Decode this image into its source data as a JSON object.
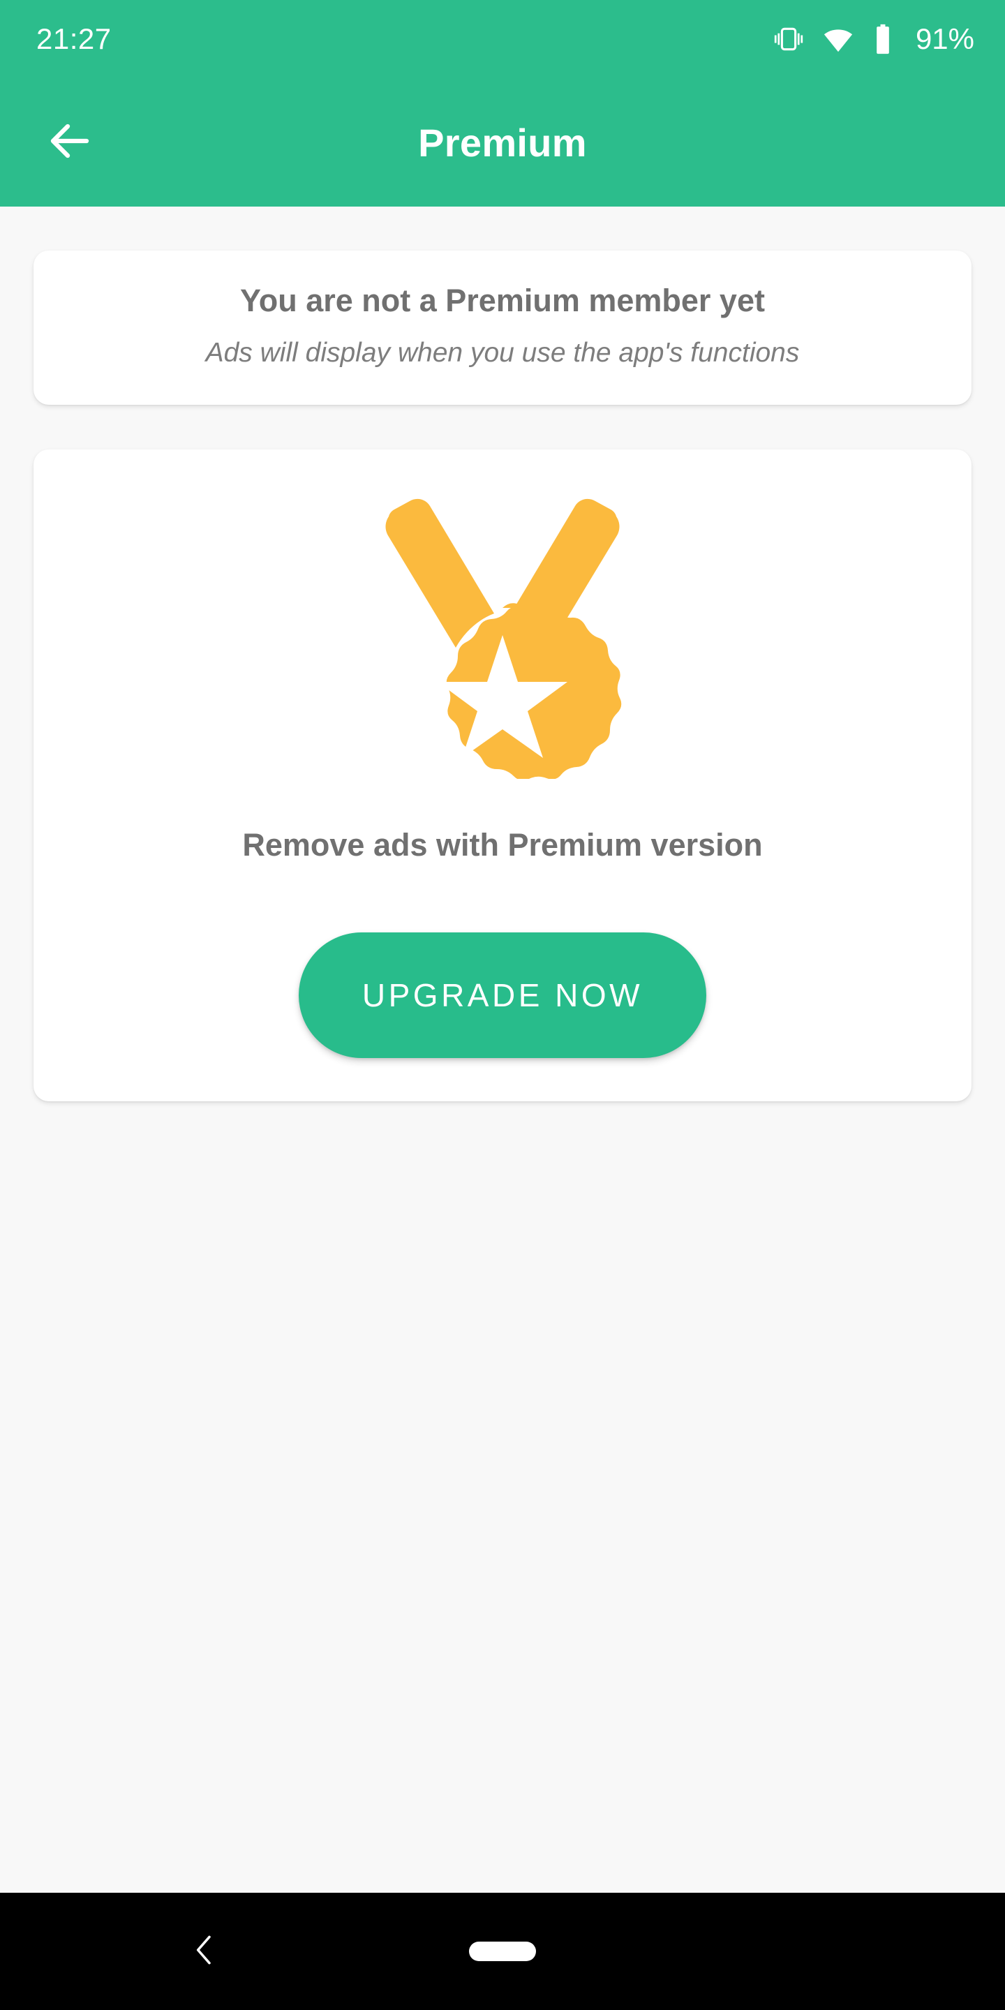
{
  "status_bar": {
    "clock": "21:27",
    "battery_percent": "91%",
    "icons": [
      "vibrate-icon",
      "wifi-icon",
      "battery-icon"
    ]
  },
  "app_bar": {
    "title": "Premium",
    "back_icon": "arrow-left-icon",
    "background_color": "#2cbd8c"
  },
  "membership_card": {
    "title": "You are not a Premium member yet",
    "subtitle": "Ads will display when you use the app's functions"
  },
  "promo_card": {
    "icon": "medal-star-icon",
    "icon_color": "#fbba3e",
    "title": "Remove ads with Premium version",
    "upgrade_label": "UPGRADE NOW",
    "upgrade_color": "#28bc8b"
  },
  "nav_bar": {
    "back_glyph": "‹",
    "home_pill": "home-pill",
    "background_color": "#000000"
  },
  "theme": {
    "accent": "#2cbd8c",
    "page_background": "#f8f8f8",
    "card_background": "#ffffff",
    "text_gray": "#707070"
  }
}
